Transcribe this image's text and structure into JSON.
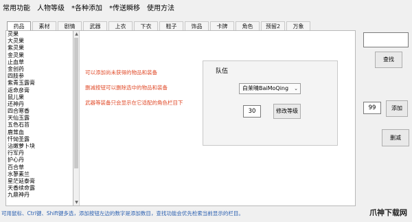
{
  "menu": [
    "常用功能",
    "人物等级",
    "*各种添加",
    "*传送瞬移",
    "使用方法"
  ],
  "tabs": [
    "药品",
    "素材",
    "剧情",
    "武器",
    "上衣",
    "下衣",
    "鞋子",
    "饰品",
    "卡牌",
    "角色",
    "预留2",
    "万象"
  ],
  "active_tab_index": 0,
  "items": [
    "灵果",
    "大灵果",
    "紫灵果",
    "金灵果",
    "止血草",
    "金创药",
    "四肢参",
    "紫青玉露膏",
    "返命彦膏",
    "鼠儿果",
    "还神丹",
    "四合寒香",
    "天仙玉露",
    "五色石苔",
    "鹿茸血",
    "忏恸圣露",
    "沾嫩萝卜块",
    "行军丹",
    "护心丹",
    "百合草",
    "水蓼素兰",
    "星茫延泰膏",
    "天香续命露",
    "九鼎神丹"
  ],
  "hints": [
    "可以添加尚未获得的物品和装备",
    "删减按钮可以删除选中的物品和装备",
    "武器等装备只会显示在它适配的角色栏目下"
  ],
  "team": {
    "title": "队伍",
    "selected_character": "白茉晴BaiMoQing",
    "dropdown_arrow": "⌄",
    "level_value": "30",
    "modify_level_label": "修改等级"
  },
  "search": {
    "value": "",
    "button_label": "查找"
  },
  "quantity": {
    "value": "99",
    "add_label": "添加"
  },
  "delete_label": "删减",
  "status_text": "可用鼠标、Ctrl键、Shift键多选，添加按钮左边的数字是添加数目，查找功能会优先检索当前显示的栏目。",
  "watermark_text": "爪神下载网"
}
